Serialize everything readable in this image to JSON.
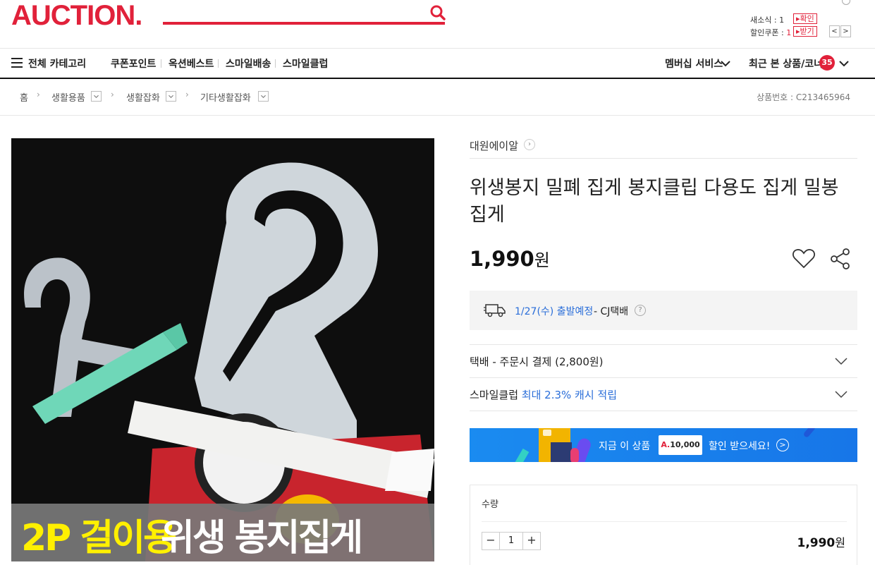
{
  "brand": {
    "logo": "AUCTION."
  },
  "header": {
    "news_label": "새소식 : ",
    "news_count": "1",
    "news_btn": "▸확인",
    "coupon_label": "할인쿠폰 : ",
    "coupon_count": "1",
    "coupon_btn": "▸받기",
    "prev": "<",
    "next": ">"
  },
  "nav": {
    "all_categories": "전체 카테고리",
    "links": [
      "쿠폰포인트",
      "옥션베스트",
      "스마일배송",
      "스마일클럽"
    ],
    "membership": "멤버십 서비스",
    "recent": "최근 본 상품/코너",
    "recent_count": "35"
  },
  "breadcrumb": {
    "home": "홈",
    "level1": "생활용품",
    "level2": "생활잡화",
    "level3": "기타생활잡화",
    "product_no": "상품번호 : C213465964"
  },
  "product": {
    "image_caption_yellow": "2P 걸이용",
    "image_caption_white": "위생 봉지집게",
    "seller": "대원에이알",
    "title": "위생봉지 밀폐 집게 봉지클립 다용도 집게 밀봉 집게",
    "price": "1,990",
    "currency": "원"
  },
  "shipping": {
    "date": "1/27(수) 출발예정",
    "carrier": " - CJ택배",
    "help": "?",
    "fee": "택배 - 주문시 결제 (2,800원)"
  },
  "smileclub": {
    "label": "스마일클럽 ",
    "benefit": "최대 2.3% 캐시 적립"
  },
  "banner": {
    "pre": "지금 이 상품",
    "coupon_mark": "A.",
    "coupon_amount": "10,000",
    "post": "할인 받으세요!",
    "arrow": ">"
  },
  "quantity": {
    "label": "수량",
    "value": "1",
    "minus": "−",
    "plus": "+",
    "total": "1,990",
    "currency": "원"
  },
  "colors": {
    "accent": "#e1213a",
    "link_blue": "#2a6ed9",
    "banner_blue": "#1a8bf0"
  }
}
